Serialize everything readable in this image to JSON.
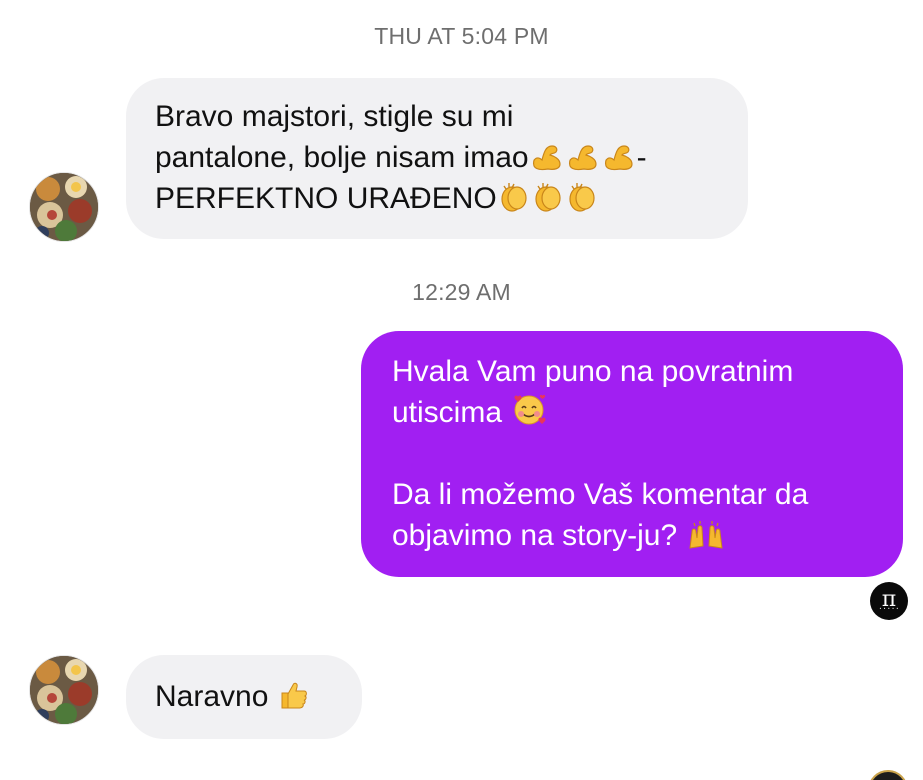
{
  "conversation": {
    "timestamp_1": "THU AT 5:04 PM",
    "timestamp_2": "12:29 AM",
    "messages": [
      {
        "sender": "contact",
        "lines": [
          {
            "text": "Bravo majstori, stigle su mi",
            "emojis": []
          },
          {
            "text": "pantalone, bolje nisam imao",
            "emojis": [
              "flexed-biceps",
              "flexed-biceps",
              "flexed-biceps"
            ],
            "suffix": "-"
          },
          {
            "text": "PERFEKTNO URAĐENO",
            "emojis": [
              "clapping-hands",
              "clapping-hands",
              "clapping-hands"
            ]
          }
        ]
      },
      {
        "sender": "me",
        "paragraphs": [
          {
            "line1": "Hvala Vam puno na povratnim",
            "line2": "utiscima",
            "emoji": "smiling-face-with-hearts"
          },
          {
            "line1": "Da li možemo Vaš komentar da",
            "line2": "objavimo na story-ju?",
            "emoji": "raising-hands"
          }
        ]
      },
      {
        "sender": "contact",
        "text": "Naravno",
        "emoji": "thumbs-up"
      }
    ],
    "seen_avatar": {
      "glyph": "π",
      "caption": "• • • • •"
    }
  },
  "colors": {
    "outgoing_bubble": "#a11ff2",
    "incoming_bubble": "#f1f1f3",
    "timestamp_text": "#6e6e6e"
  }
}
